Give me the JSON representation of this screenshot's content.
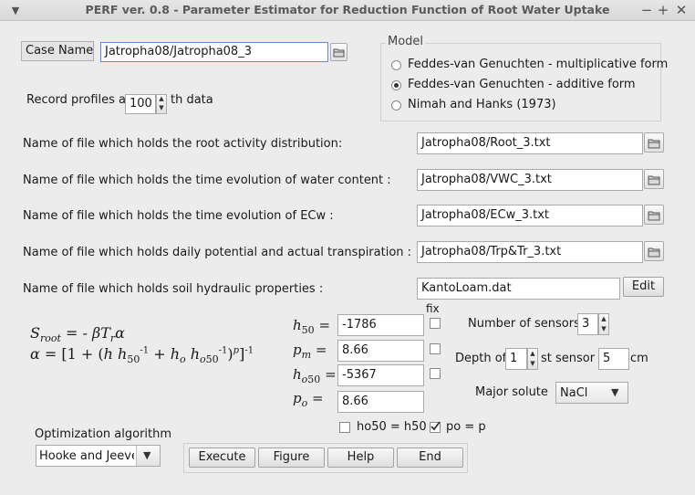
{
  "window": {
    "title": "PERF ver. 0.8 - Parameter Estimator for Reduction Function of Root Water Uptake"
  },
  "case": {
    "label": "Case Name",
    "value": "Jatropha08/Jatropha08_3"
  },
  "model": {
    "title": "Model",
    "options": [
      {
        "label": "Feddes-van Genuchten - multiplicative form",
        "selected": false
      },
      {
        "label": "Feddes-van Genuchten - additive form",
        "selected": true
      },
      {
        "label": "Nimah and Hanks (1973)",
        "selected": false
      }
    ]
  },
  "record": {
    "label_before": "Record profiles at",
    "value": "100",
    "label_after": "th data"
  },
  "files": [
    {
      "label": "Name of file which holds the root activity distribution:",
      "value": "Jatropha08/Root_3.txt"
    },
    {
      "label": "Name of file which holds the time evolution of water content :",
      "value": "Jatropha08/VWC_3.txt"
    },
    {
      "label": "Name of file which holds the time evolution of ECw :",
      "value": "Jatropha08/ECw_3.txt"
    },
    {
      "label": "Name of file which holds daily potential and actual transpiration :",
      "value": "Jatropha08/Trp&Tr_3.txt"
    }
  ],
  "soil": {
    "label": "Name of file which holds soil hydraulic properties :",
    "value": "KantoLoam.dat",
    "edit_label": "Edit"
  },
  "params": {
    "fix_label": "fix",
    "h50": {
      "value": "-1786"
    },
    "pm": {
      "value": "8.66"
    },
    "ho50": {
      "value": "-5367"
    },
    "po": {
      "value": "8.66"
    }
  },
  "sensors": {
    "count_label": "Number of sensors:",
    "count_value": "3",
    "depth_label_before": "Depth of",
    "depth_index": "1",
    "depth_label_mid": "st sensor :",
    "depth_value": "5",
    "depth_unit": "cm"
  },
  "solute": {
    "label": "Major solute",
    "value": "NaCl"
  },
  "links": {
    "ho50_eq_h50": {
      "label": "ho50 = h50",
      "checked": false
    },
    "po_eq_p": {
      "label": "po = p",
      "checked": true
    }
  },
  "optimization": {
    "label": "Optimization algorithm",
    "value": "Hooke and Jeeves"
  },
  "actions": {
    "execute": "Execute",
    "figure": "Figure",
    "help": "Help",
    "end": "End"
  }
}
